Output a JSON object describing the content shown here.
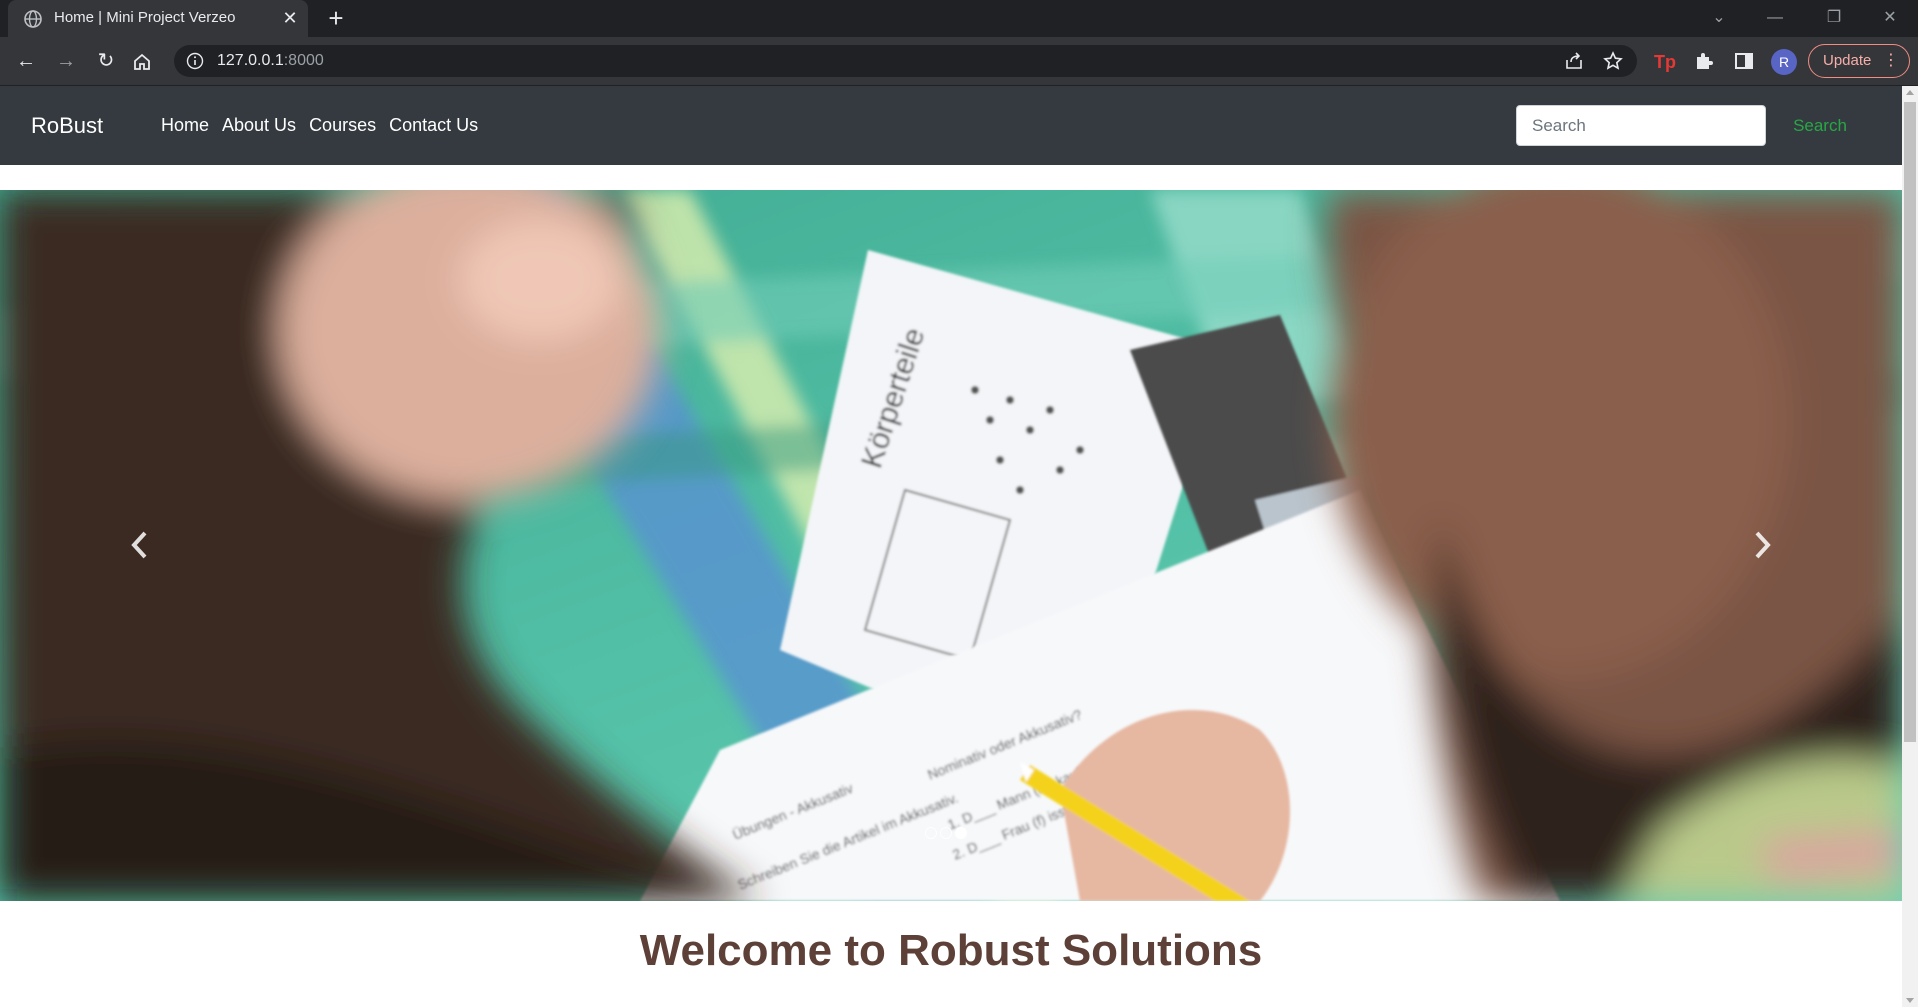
{
  "browser": {
    "tab_title": "Home | Mini Project Verzeo",
    "url_host": "127.0.0.1",
    "url_port": ":8000",
    "profile_initial": "R",
    "update_label": "Update"
  },
  "navbar": {
    "brand": "RoBust",
    "links": [
      "Home",
      "About Us",
      "Courses",
      "Contact Us"
    ],
    "search_placeholder": "Search",
    "search_button": "Search"
  },
  "carousel": {
    "slide_count": 3,
    "active_index": 2,
    "image_subject": "two people studying German worksheets on a picnic blanket"
  },
  "main": {
    "heading": "Welcome to Robust Solutions"
  },
  "colors": {
    "navbar_bg": "#343a40",
    "search_button": "#28a745",
    "heading": "#5d4037"
  }
}
